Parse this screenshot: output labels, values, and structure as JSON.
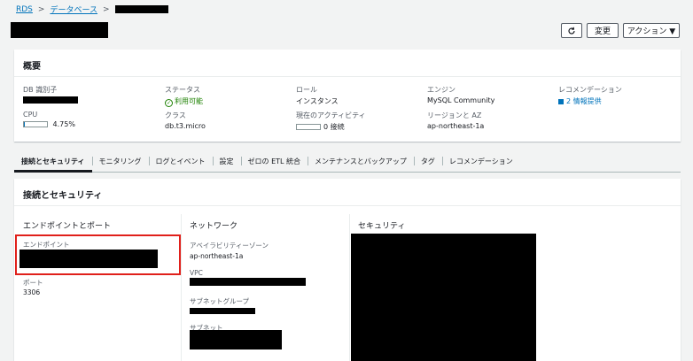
{
  "breadcrumb": {
    "root": "RDS",
    "databases": "データベース"
  },
  "buttons": {
    "refresh_icon": "refresh-icon",
    "modify": "変更",
    "actions": "アクション ▼"
  },
  "summary": {
    "title": "概要",
    "db_identifier": {
      "label": "DB 識別子"
    },
    "cpu": {
      "label": "CPU",
      "value": "4.75%",
      "percent": 4.75
    },
    "status": {
      "label": "ステータス",
      "value": "利用可能"
    },
    "class": {
      "label": "クラス",
      "value": "db.t3.micro"
    },
    "role": {
      "label": "ロール",
      "value": "インスタンス"
    },
    "current_activity": {
      "label": "現在のアクティビティ",
      "value": "0 接続"
    },
    "engine": {
      "label": "エンジン",
      "value": "MySQL Community"
    },
    "region": {
      "label": "リージョンと AZ",
      "value": "ap-northeast-1a"
    },
    "recommendations": {
      "label": "レコメンデーション",
      "value": "2 情報提供"
    }
  },
  "tabs": [
    {
      "label": "接続とセキュリティ"
    },
    {
      "label": "モニタリング"
    },
    {
      "label": "ログとイベント"
    },
    {
      "label": "設定"
    },
    {
      "label": "ゼロの ETL 統合"
    },
    {
      "label": "メンテナンスとバックアップ"
    },
    {
      "label": "タグ"
    },
    {
      "label": "レコメンデーション"
    }
  ],
  "connectivity": {
    "title": "接続とセキュリティ",
    "endpoint_port": {
      "title": "エンドポイントとポート",
      "endpoint_label": "エンドポイント",
      "port_label": "ポート",
      "port_value": "3306"
    },
    "network": {
      "title": "ネットワーク",
      "az_label": "アベイラビリティーゾーン",
      "az_value": "ap-northeast-1a",
      "vpc_label": "VPC",
      "subnet_group_label": "サブネットグループ",
      "subnet_label": "サブネット"
    },
    "security": {
      "title": "セキュリティ"
    }
  },
  "colors": {
    "accent": "#0073bb",
    "ok": "#1d8102",
    "highlight": "#e0201b"
  }
}
